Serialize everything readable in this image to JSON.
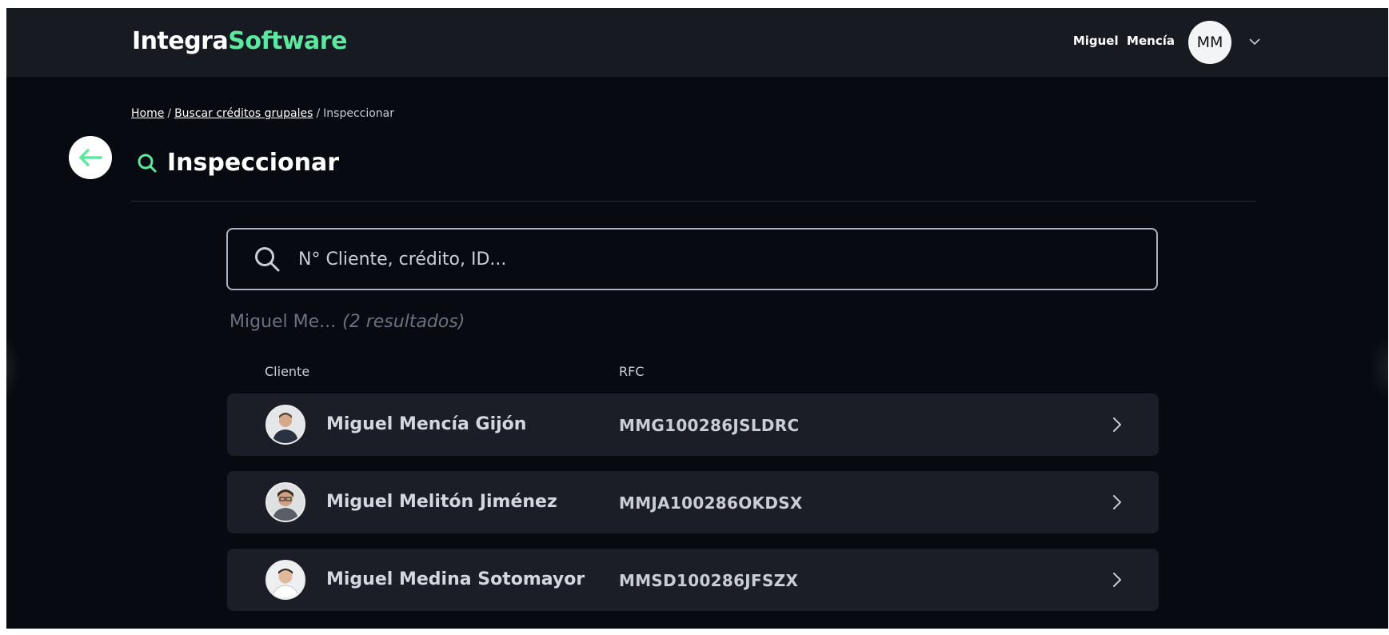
{
  "header": {
    "logo_part1": "Integra",
    "logo_part2": "Software",
    "user_name": "Miguel  Mencía",
    "user_initials": "MM"
  },
  "breadcrumb": {
    "home": "Home",
    "search": "Buscar créditos grupales",
    "current": "Inspeccionar",
    "separator": "/"
  },
  "page": {
    "title": "Inspeccionar"
  },
  "search": {
    "placeholder": "N° Cliente, crédito, ID...",
    "value": ""
  },
  "results": {
    "query": "Miguel Me...",
    "count_label": "(2 resultados)",
    "columns": {
      "client": "Cliente",
      "rfc": "RFC"
    },
    "rows": [
      {
        "name": "Miguel Mencía Gijón",
        "rfc": "MMG100286JSLDRC"
      },
      {
        "name": "Miguel Melitón Jiménez",
        "rfc": "MMJA100286OKDSX"
      },
      {
        "name": "Miguel Medina Sotomayor",
        "rfc": "MMSD100286JFSZX"
      }
    ]
  },
  "colors": {
    "accent": "#5ee89f",
    "background": "#070a10",
    "topbar": "#171a21",
    "row": "#1b1e26"
  },
  "icons": {
    "back": "arrow-left-icon",
    "search": "search-icon",
    "chevron_down": "chevron-down-icon",
    "row_arrow": "chevron-right-icon"
  }
}
